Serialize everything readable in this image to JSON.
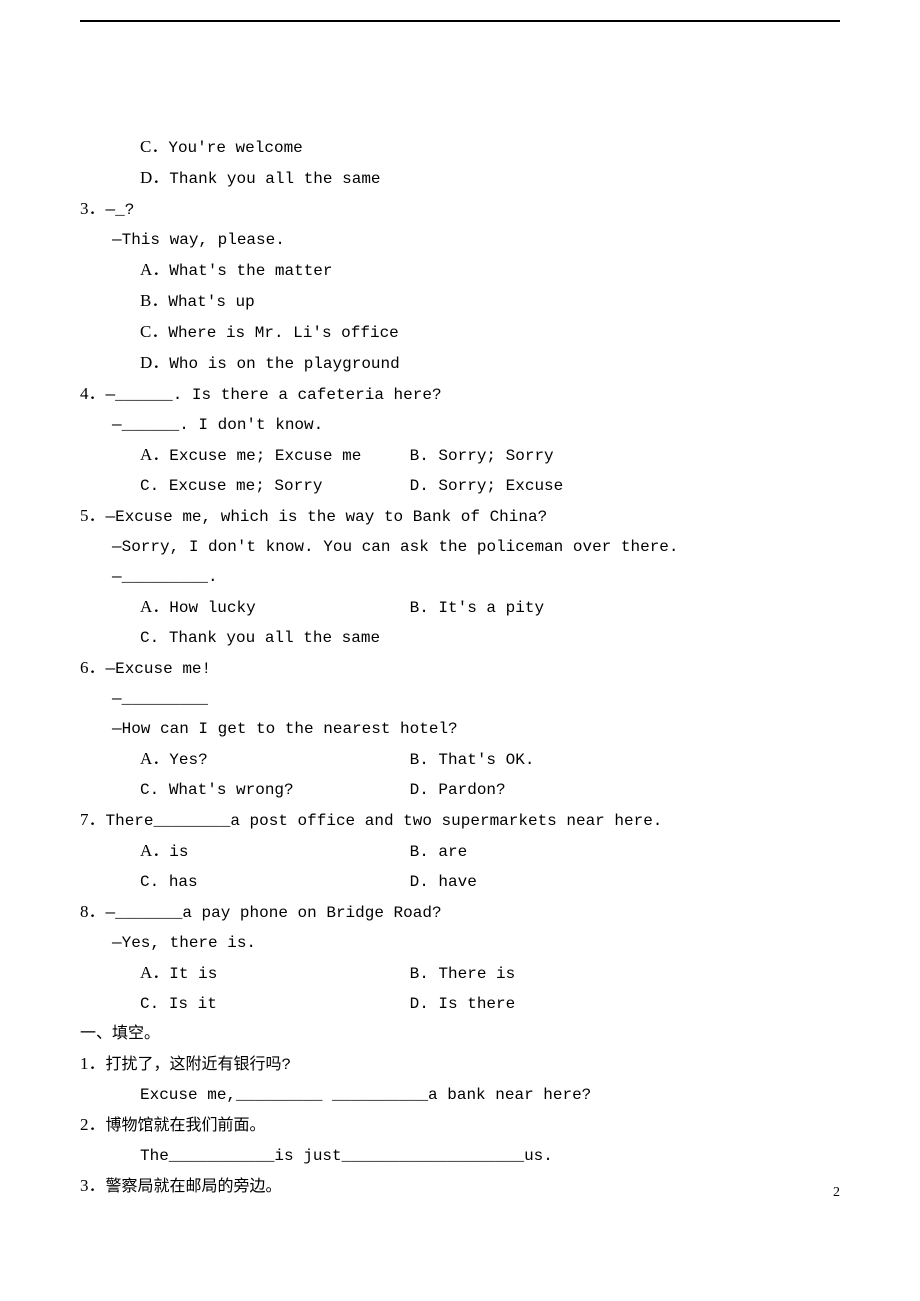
{
  "q2_continued": {
    "optC": {
      "letter": "C．",
      "text": "You're welcome"
    },
    "optD": {
      "letter": "D．",
      "text": "Thank you all the same"
    }
  },
  "q3": {
    "num": "3．",
    "prompt": "—_?",
    "reply": "—This way, please.",
    "optA": {
      "letter": "A．",
      "text": "What's the matter"
    },
    "optB": {
      "letter": "B．",
      "text": "What's up"
    },
    "optC": {
      "letter": "C．",
      "text": "Where is Mr. Li's office"
    },
    "optD": {
      "letter": "D．",
      "text": "Who is on the playground"
    }
  },
  "q4": {
    "num": "4．",
    "prompt": "—______. Is there a cafeteria here?",
    "reply": "—______. I don't know.",
    "optA": {
      "letter": "A．",
      "text": "Excuse me; Excuse me"
    },
    "optB": {
      "letter": "B. ",
      "text": "Sorry; Sorry"
    },
    "optC": {
      "letter": "C. ",
      "text": "Excuse me; Sorry"
    },
    "optD": {
      "letter": "D. ",
      "text": "Sorry; Excuse"
    }
  },
  "q5": {
    "num": "5．",
    "prompt": "—Excuse me, which is the way to Bank of China?",
    "reply": "—Sorry, I don't know. You can ask the policeman over there.",
    "reply2": "—_________.",
    "optA": {
      "letter": "A．",
      "text": "How lucky"
    },
    "optB": {
      "letter": "B. ",
      "text": "It's a pity"
    },
    "optC": {
      "letter": "C. ",
      "text": "Thank you all the same"
    }
  },
  "q6": {
    "num": "6．",
    "prompt": "—Excuse me!",
    "reply": "—_________",
    "reply2": "—How can I get to the nearest hotel?",
    "optA": {
      "letter": "A．",
      "text": "Yes?"
    },
    "optB": {
      "letter": "B. ",
      "text": "That's OK."
    },
    "optC": {
      "letter": "C. ",
      "text": "What's wrong?"
    },
    "optD": {
      "letter": "D. ",
      "text": "Pardon?"
    }
  },
  "q7": {
    "num": "7．",
    "prompt": "There________a post office and two supermarkets near here.",
    "optA": {
      "letter": "A．",
      "text": "is"
    },
    "optB": {
      "letter": "B. ",
      "text": "are"
    },
    "optC": {
      "letter": "C. ",
      "text": "has"
    },
    "optD": {
      "letter": "D. ",
      "text": "have"
    }
  },
  "q8": {
    "num": "8．",
    "prompt": "—_______a pay phone on Bridge Road?",
    "reply": "—Yes, there is.",
    "optA": {
      "letter": "A．",
      "text": "It is"
    },
    "optB": {
      "letter": "B. ",
      "text": "There is"
    },
    "optC": {
      "letter": "C. ",
      "text": "Is it"
    },
    "optD": {
      "letter": "D. ",
      "text": "Is there"
    }
  },
  "section2": {
    "title": "一、填空。"
  },
  "fill1": {
    "num": "1．",
    "cn": "打扰了，这附近有银行吗?",
    "en": "Excuse me,_________  __________a bank near here?"
  },
  "fill2": {
    "num": "2．",
    "cn": "博物馆就在我们前面。",
    "en": "The___________is just___________________us."
  },
  "fill3": {
    "num": "3．",
    "cn": "警察局就在邮局的旁边。"
  },
  "pageNumber": "2"
}
